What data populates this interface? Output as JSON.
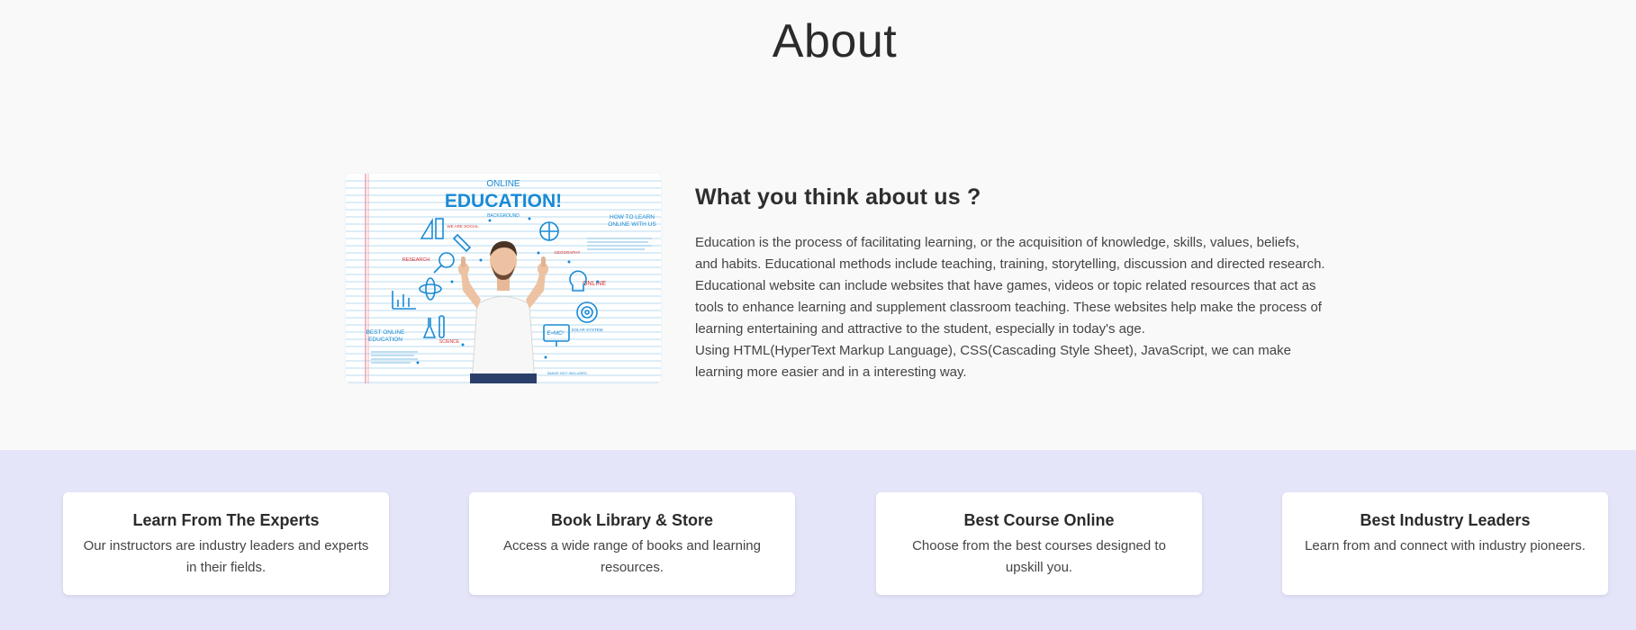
{
  "page": {
    "title": "About"
  },
  "about": {
    "image_alt": "Online education illustration",
    "image_texts": {
      "online": "ONLINE",
      "education": "EDUCATION!",
      "background": "BACKGROUND",
      "how_to_learn": "HOW TO LEARN ONLINE WITH US",
      "research": "RESEARCH",
      "online_small": "ONLINE",
      "best_online": "BEST ONLINE EDUCATION",
      "science": "SCIENCE",
      "geography": "GEOGRAPHY",
      "solar_system": "SOLAR SYSTEM",
      "we_are": "WE ARE SOCIAL",
      "formula": "E=MC²",
      "footer": "IMAGE NOT INCLUDED"
    },
    "heading": "What you think about us ?",
    "paragraph_1": "Education is the process of facilitating learning, or the acquisition of knowledge, skills, values, beliefs, and habits. Educational methods include teaching, training, storytelling, discussion and directed research. Educational website can include websites that have games, videos or topic related resources that act as tools to enhance learning and supplement classroom teaching. These websites help make the process of learning entertaining and attractive to the student, especially in today's age.",
    "paragraph_2": "Using HTML(HyperText Markup Language), CSS(Cascading Style Sheet), JavaScript, we can make learning more easier and in a interesting way."
  },
  "features": [
    {
      "title": "Learn From The Experts",
      "description": "Our instructors are industry leaders and experts in their fields."
    },
    {
      "title": "Book Library & Store",
      "description": "Access a wide range of books and learning resources."
    },
    {
      "title": "Best Course Online",
      "description": "Choose from the best courses designed to upskill you."
    },
    {
      "title": "Best Industry Leaders",
      "description": "Learn from and connect with industry pioneers."
    }
  ],
  "colors": {
    "page_background": "#f9f9f9",
    "features_background": "#e5e5fa",
    "card_background": "#ffffff",
    "illustration_blue": "#1a8ad4",
    "illustration_red": "#e03030"
  }
}
